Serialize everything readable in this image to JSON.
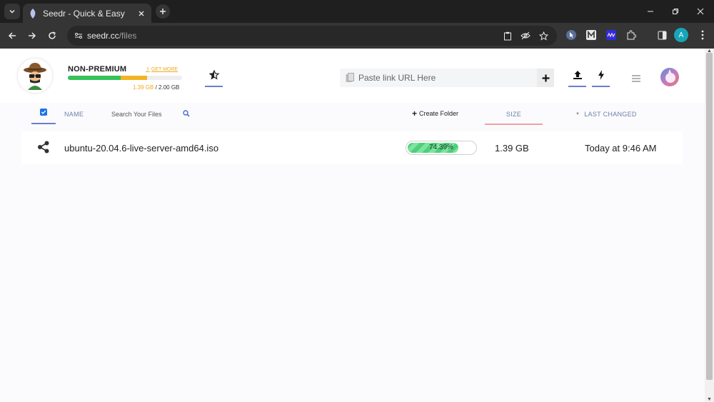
{
  "browser": {
    "tab_title": "Seedr - Quick & Easy",
    "url_host": "seedr.cc",
    "url_path": "/files",
    "profile_initial": "A"
  },
  "header": {
    "plan": "NON-PREMIUM",
    "get_more": "GET MORE",
    "storage_used": "1.39 GB",
    "storage_sep": " / ",
    "storage_total": "2.00 GB",
    "storage_fraction": 0.695,
    "link_placeholder": "Paste link URL Here"
  },
  "list": {
    "name_label": "NAME",
    "search_placeholder": "Search Your Files",
    "create_folder": "Create Folder",
    "size_label": "SIZE",
    "changed_label": "LAST CHANGED"
  },
  "files": [
    {
      "name": "ubuntu-20.04.6-live-server-amd64.iso",
      "progress_text": "74.39%",
      "progress": 0.7439,
      "size": "1.39 GB",
      "changed": "Today at 9:46 AM"
    }
  ],
  "colors": {
    "accent": "#6a7fd0",
    "storage_green": "#35c35a",
    "storage_orange": "#f2b424",
    "progress_green": "#4dd07a",
    "size_underline": "#f0a0a0"
  }
}
